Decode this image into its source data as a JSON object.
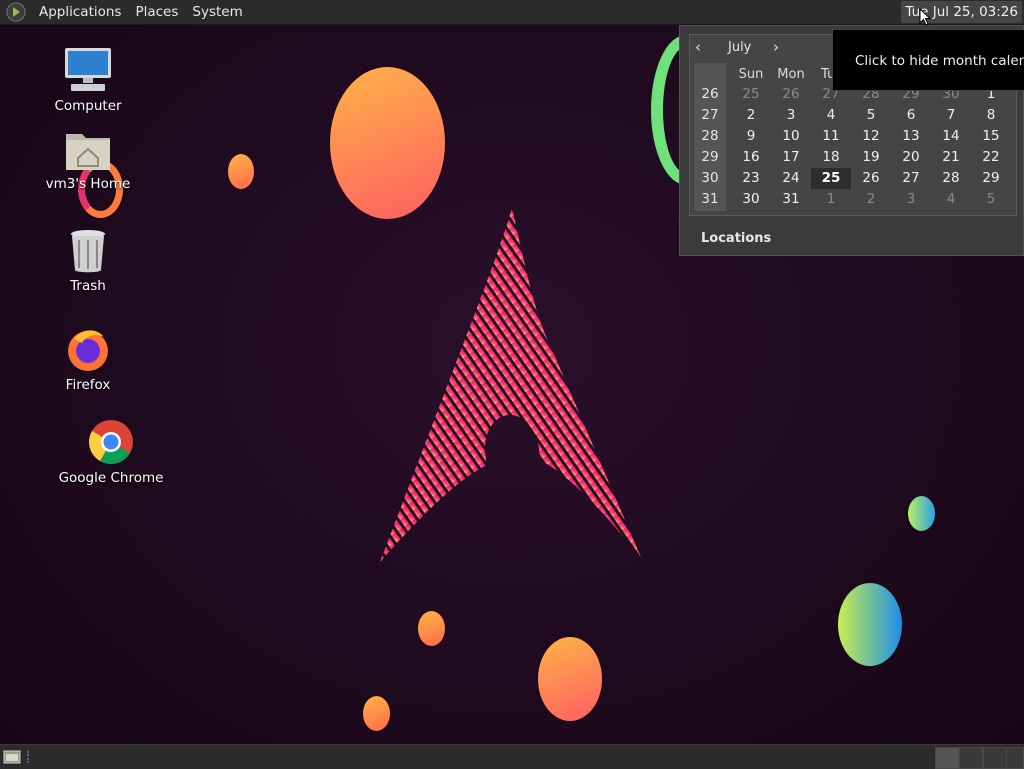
{
  "top_panel": {
    "menus": [
      "Applications",
      "Places",
      "System"
    ],
    "clock": "Tue Jul 25, 03:26"
  },
  "desktop": {
    "icons": [
      {
        "label": "Computer",
        "icon": "computer-icon"
      },
      {
        "label": "vm3's Home",
        "icon": "home-folder-icon"
      },
      {
        "label": "Trash",
        "icon": "trash-icon"
      },
      {
        "label": "Firefox",
        "icon": "firefox-icon"
      },
      {
        "label": "Google Chrome",
        "icon": "chrome-icon"
      }
    ]
  },
  "calendar": {
    "month": "July",
    "prev": "‹",
    "next": "›",
    "weekdays": [
      "Sun",
      "Mon",
      "Tu"
    ],
    "week_numbers": [
      "26",
      "27",
      "28",
      "29",
      "30",
      "31"
    ],
    "rows": [
      [
        "25",
        "26",
        "27",
        "28",
        "29",
        "30",
        "1"
      ],
      [
        "2",
        "3",
        "4",
        "5",
        "6",
        "7",
        "8"
      ],
      [
        "9",
        "10",
        "11",
        "12",
        "13",
        "14",
        "15"
      ],
      [
        "16",
        "17",
        "18",
        "19",
        "20",
        "21",
        "22"
      ],
      [
        "23",
        "24",
        "25",
        "26",
        "27",
        "28",
        "29"
      ],
      [
        "30",
        "31",
        "1",
        "2",
        "3",
        "4",
        "5"
      ]
    ],
    "today": "25",
    "locations_label": "Locations"
  },
  "tooltip": {
    "text": "Click to hide month calendar"
  },
  "colors": {
    "panel": "#2b2b2b",
    "desktop_bg": "#1e0a1e",
    "today_bg": "#2d2d2d"
  }
}
